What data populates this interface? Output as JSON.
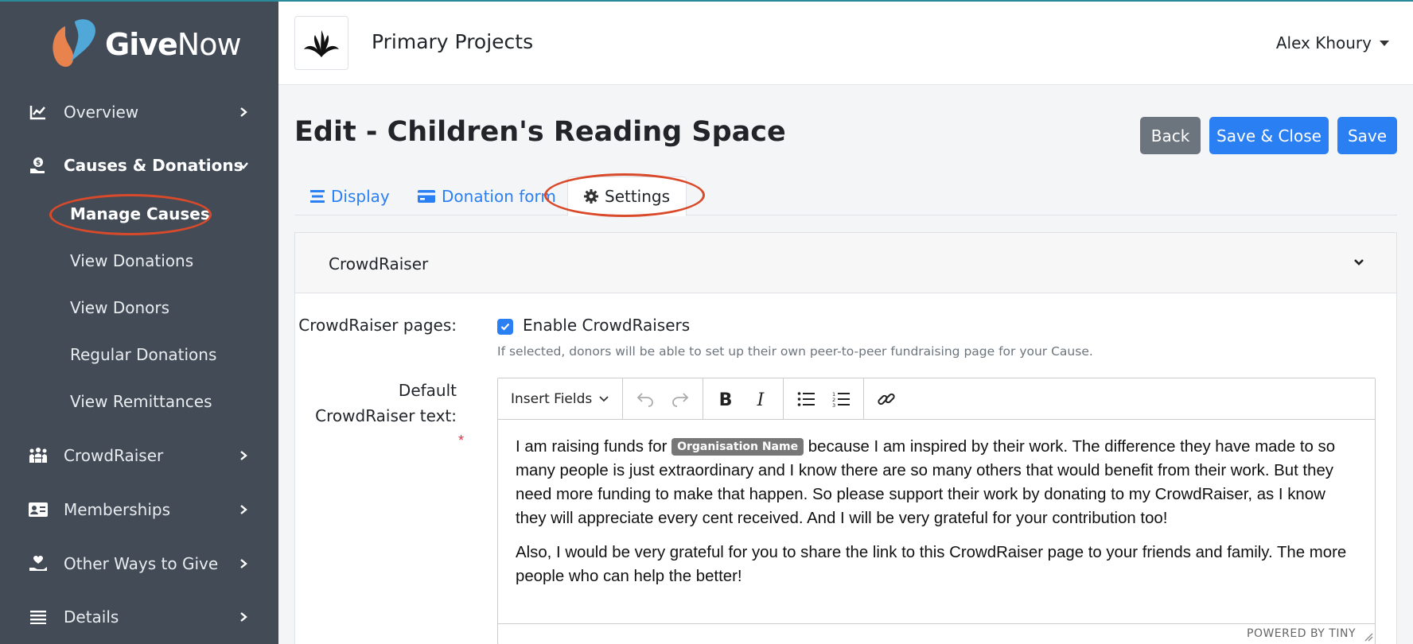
{
  "app": {
    "brand_bold": "Give",
    "brand_light": "Now"
  },
  "colors": {
    "sidebar": "#434b57",
    "primary": "#2a7ff2",
    "secondary": "#6c757d",
    "highlight": "#d94a2b"
  },
  "sidebar": {
    "items": [
      {
        "label": "Overview",
        "icon": "chart-line-icon"
      },
      {
        "label": "Causes & Donations",
        "icon": "hand-coin-icon",
        "expanded": true
      },
      {
        "label": "CrowdRaiser",
        "icon": "people-group-icon"
      },
      {
        "label": "Memberships",
        "icon": "id-card-icon"
      },
      {
        "label": "Other Ways to Give",
        "icon": "hand-heart-icon"
      },
      {
        "label": "Details",
        "icon": "list-icon"
      }
    ],
    "subitems": [
      "Manage Causes",
      "View Donations",
      "View Donors",
      "Regular Donations",
      "View Remittances"
    ]
  },
  "header": {
    "org_name": "Primary Projects",
    "user_name": "Alex Khoury"
  },
  "page": {
    "title": "Edit - Children's Reading Space"
  },
  "actions": {
    "back": "Back",
    "save_close": "Save & Close",
    "save": "Save"
  },
  "tabs": [
    {
      "label": "Display",
      "icon": "align-icon"
    },
    {
      "label": "Donation form",
      "icon": "credit-card-icon"
    },
    {
      "label": "Settings",
      "icon": "gear-icon",
      "active": true
    }
  ],
  "section": {
    "title": "CrowdRaiser",
    "crowdraiser_pages_label": "CrowdRaiser pages:",
    "enable_label": "Enable CrowdRaisers",
    "enable_checked": true,
    "help_text": "If selected, donors will be able to set up their own peer-to-peer fundraising page for your Cause.",
    "default_text_label_1": "Default",
    "default_text_label_2": "CrowdRaiser text:",
    "required_mark": "*"
  },
  "editor": {
    "insert_fields": "Insert Fields",
    "para1_before": "I am raising funds for ",
    "merge_tag": "Organisation Name",
    "para1_after": " because I am inspired by their work. The difference they have made to so many people is just extraordinary and I know there are so many others that would benefit from their work. But they need more funding to make that happen. So please support their work by donating to my CrowdRaiser, as I know they will appreciate every cent received. And I will be very grateful for your contribution too!",
    "para2": "Also, I would be very grateful for you to share the link to this CrowdRaiser page to your friends and family. The more people who can help the better!",
    "powered_by": "POWERED BY TINY"
  }
}
